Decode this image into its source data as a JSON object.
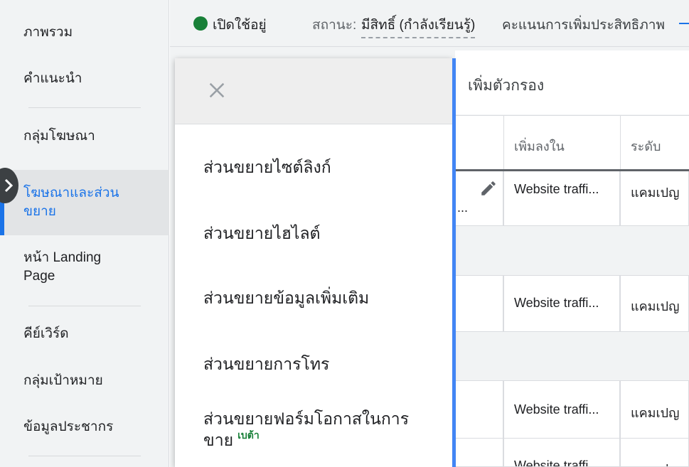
{
  "sidebar": {
    "items": [
      {
        "label": "ภาพรวม"
      },
      {
        "label": "คำแนะนำ"
      },
      {
        "label": "กลุ่มโฆษณา"
      },
      {
        "label": "โฆษณาและส่วน"
      },
      {
        "label": "ขยาย"
      },
      {
        "label": "หน้า Landing"
      },
      {
        "label": "Page"
      },
      {
        "label": "คีย์เวิร์ด"
      },
      {
        "label": "กลุ่มเป้าหมาย"
      },
      {
        "label": "ข้อมูลประชากร"
      }
    ]
  },
  "status": {
    "state": "เปิดใช้อยู่",
    "status_label": "สถานะ:",
    "status_value": "มีสิทธิ์ (กำลังเรียนรู้)",
    "optimization_label": "คะแนนการเพิ่มประสิทธิภาพ"
  },
  "table": {
    "filter_label": "เพิ่มตัวกรอง",
    "columns": [
      "เพิ่มลงใน",
      "ระดับ"
    ],
    "rows": [
      {
        "added_to": "Website traffi...",
        "level": "แคมเปญ"
      },
      {
        "added_to": "Website traffi...",
        "level": "แคมเปญ"
      },
      {
        "added_to": "Website traffi...",
        "level": "แคมเปญ"
      },
      {
        "added_to": "Website traffi...",
        "level": "แคมเปญ"
      }
    ],
    "truncation": "..."
  },
  "menu": {
    "items": [
      {
        "label": "ส่วนขยายไซต์ลิงก์"
      },
      {
        "label": "ส่วนขยายไฮไลต์"
      },
      {
        "label": "ส่วนขยายข้อมูลเพิ่มเติม"
      },
      {
        "label": "ส่วนขยายการโทร"
      },
      {
        "label": "ส่วนขยายฟอร์มโอกาสในการ"
      },
      {
        "label": "ขาย"
      }
    ],
    "beta": "เบต้า"
  },
  "colors": {
    "accent": "#1a73e8",
    "active_status": "#188038",
    "panel_bar": "#4285f4"
  },
  "icons": [
    "chevron-right-icon",
    "close-icon",
    "pencil-icon",
    "status-dot-icon"
  ]
}
